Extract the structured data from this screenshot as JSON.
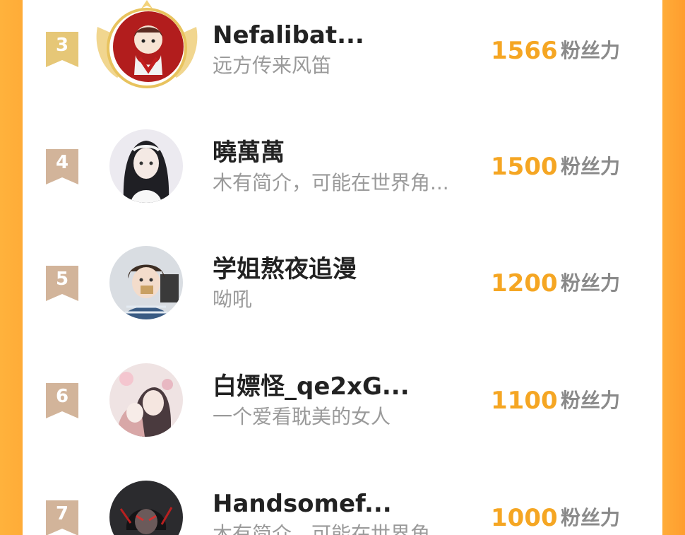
{
  "colors": {
    "accent_orange": "#ffac38",
    "score_color": "#f5a623",
    "name_color": "#222222",
    "bio_color": "#9a9a9a",
    "gold_badge": "#e6c777",
    "bronze_badge": "#d2b49a"
  },
  "score_unit": "粉丝力",
  "rows": [
    {
      "rank": "3",
      "name": "Nefalibat...",
      "bio": "远方传来风笛",
      "score": "1566",
      "avatar": "anime-avatar-red-icon",
      "badge": "gold"
    },
    {
      "rank": "4",
      "name": "曉萬萬",
      "bio": "木有简介，可能在世界角...",
      "score": "1500",
      "avatar": "anime-avatar-girl-icon",
      "badge": "bronze"
    },
    {
      "rank": "5",
      "name": "学姐熬夜追漫",
      "bio": "呦吼",
      "score": "1200",
      "avatar": "anime-avatar-boy-icon",
      "badge": "bronze"
    },
    {
      "rank": "6",
      "name": "白嫖怪_qe2xG...",
      "bio": "一个爱看耽美的女人",
      "score": "1100",
      "avatar": "anime-avatar-couple-icon",
      "badge": "bronze"
    },
    {
      "rank": "7",
      "name": "Handsomef...",
      "bio": "木有简介，可能在世界角...",
      "score": "1000",
      "avatar": "anime-avatar-dark-icon",
      "badge": "bronze"
    }
  ]
}
